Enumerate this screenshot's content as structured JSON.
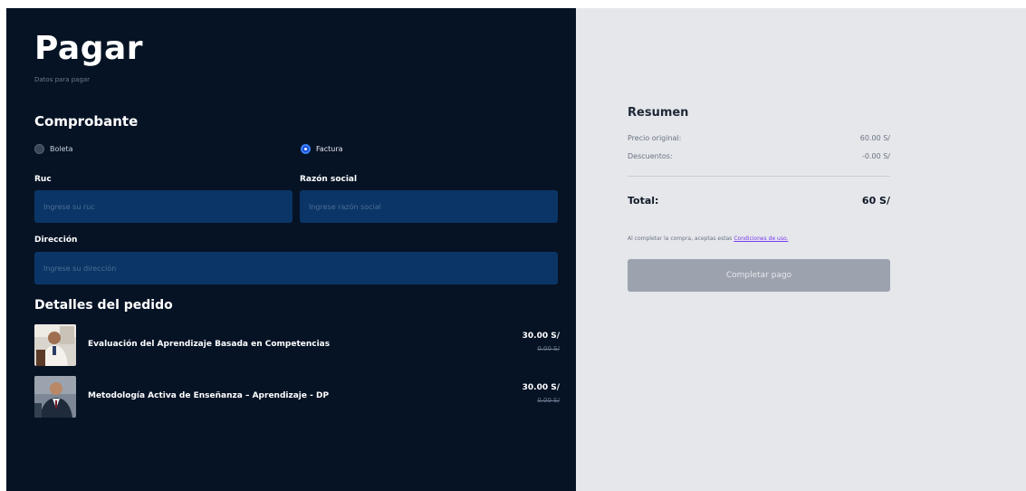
{
  "header": {
    "title": "Pagar",
    "subtitle": "Datos para pagar"
  },
  "receipt": {
    "title": "Comprobante",
    "options": [
      {
        "label": "Boleta",
        "selected": false
      },
      {
        "label": "Factura",
        "selected": true
      }
    ]
  },
  "form": {
    "ruc": {
      "label": "Ruc",
      "placeholder": "Ingrese su ruc",
      "value": ""
    },
    "razon_social": {
      "label": "Razón social",
      "placeholder": "Ingrese razón social",
      "value": ""
    },
    "direccion": {
      "label": "Dirección",
      "placeholder": "Ingrese su dirección",
      "value": ""
    }
  },
  "order": {
    "title": "Detalles del pedido",
    "items": [
      {
        "name": "Evaluación del Aprendizaje Basada en Competencias",
        "price": "30.00 S/",
        "old_price": "0.00 S/"
      },
      {
        "name": "Metodología Activa de Enseñanza – Aprendizaje - DP",
        "price": "30.00 S/",
        "old_price": "0.00 S/"
      }
    ]
  },
  "summary": {
    "title": "Resumen",
    "original_label": "Precio original:",
    "original_value": "60.00 S/",
    "discount_label": "Descuentos:",
    "discount_value": "-0.00 S/",
    "total_label": "Total:",
    "total_value": "60 S/",
    "terms_text": "Al completar la compra, aceptas estas",
    "terms_link": "Condiciones de uso.",
    "button_label": "Completar pago"
  },
  "colors": {
    "left_bg": "#061325",
    "right_bg": "#e5e7eb",
    "field_bg": "#0b3566",
    "accent": "#1d4ed8",
    "link": "#7c3aed",
    "button_disabled": "#9ca3af"
  }
}
